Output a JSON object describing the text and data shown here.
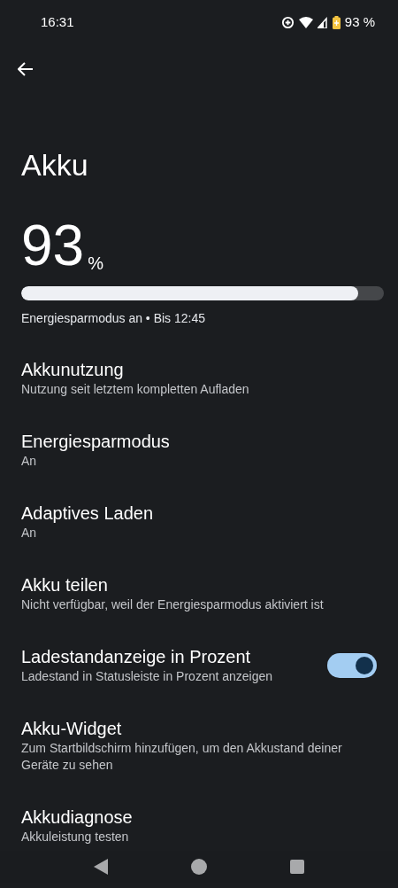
{
  "status_bar": {
    "time": "16:31",
    "battery_text": "93 %"
  },
  "title": "Akku",
  "battery": {
    "value": "93",
    "unit": "%",
    "level": 0.93,
    "status": "Energiesparmodus an • Bis 12:45"
  },
  "items": [
    {
      "kind": "plain",
      "title": "Akkunutzung",
      "summary": "Nutzung seit letztem kompletten Aufladen"
    },
    {
      "kind": "plain",
      "title": "Energiesparmodus",
      "summary": "An"
    },
    {
      "kind": "plain",
      "title": "Adaptives Laden",
      "summary": "An"
    },
    {
      "kind": "plain",
      "title": "Akku teilen",
      "summary": "Nicht verfügbar, weil der Energiesparmodus aktiviert ist"
    },
    {
      "kind": "toggle",
      "title": "Ladestandanzeige in Prozent",
      "summary": "Ladestand in Statusleiste in Prozent anzeigen",
      "on": true
    },
    {
      "kind": "plain",
      "title": "Akku-Widget",
      "summary": "Zum Startbildschirm hinzufügen, um den Akkustand deiner Geräte zu sehen"
    },
    {
      "kind": "plain",
      "title": "Akkudiagnose",
      "summary": "Akkuleistung testen"
    }
  ]
}
